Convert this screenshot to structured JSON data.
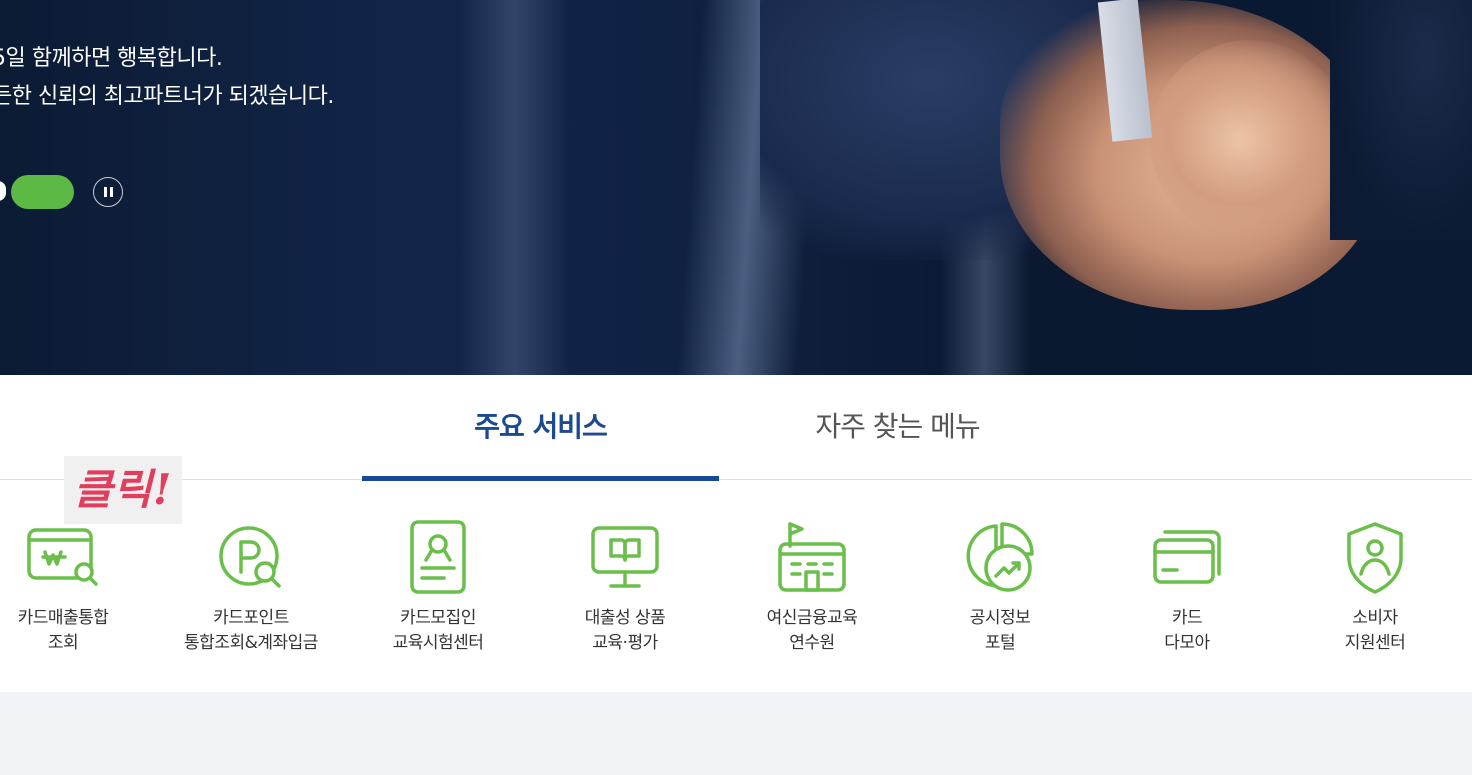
{
  "hero": {
    "line1": "5일 함께하면 행복합니다.",
    "line2": "든한 신뢰의 최고파트너가 되겠습니다.",
    "accent_color": "#5cb945",
    "pause_icon": "pause-icon"
  },
  "tabs": [
    {
      "label": "주요 서비스",
      "active": true
    },
    {
      "label": "자주 찾는 메뉴",
      "active": false
    }
  ],
  "click_badge": "클릭!",
  "services": [
    {
      "line1": "카드매출통합",
      "line2": "조회",
      "icon": "card-sales-search-icon"
    },
    {
      "line1": "카드포인트",
      "line2": "통합조회&계좌입금",
      "icon": "point-search-icon"
    },
    {
      "line1": "카드모집인",
      "line2": "교육시험센터",
      "icon": "certificate-icon"
    },
    {
      "line1": "대출성 상품",
      "line2": "교육·평가",
      "icon": "monitor-book-icon"
    },
    {
      "line1": "여신금융교육",
      "line2": "연수원",
      "icon": "school-building-icon"
    },
    {
      "line1": "공시정보",
      "line2": "포털",
      "icon": "pie-chart-trend-icon"
    },
    {
      "line1": "카드",
      "line2": "다모아",
      "icon": "cards-stack-icon"
    },
    {
      "line1": "소비자",
      "line2": "지원센터",
      "icon": "shield-user-icon"
    }
  ],
  "colors": {
    "brand_blue": "#1b4a91",
    "icon_green": "#6abf4b",
    "badge_red": "#e23d5c"
  }
}
